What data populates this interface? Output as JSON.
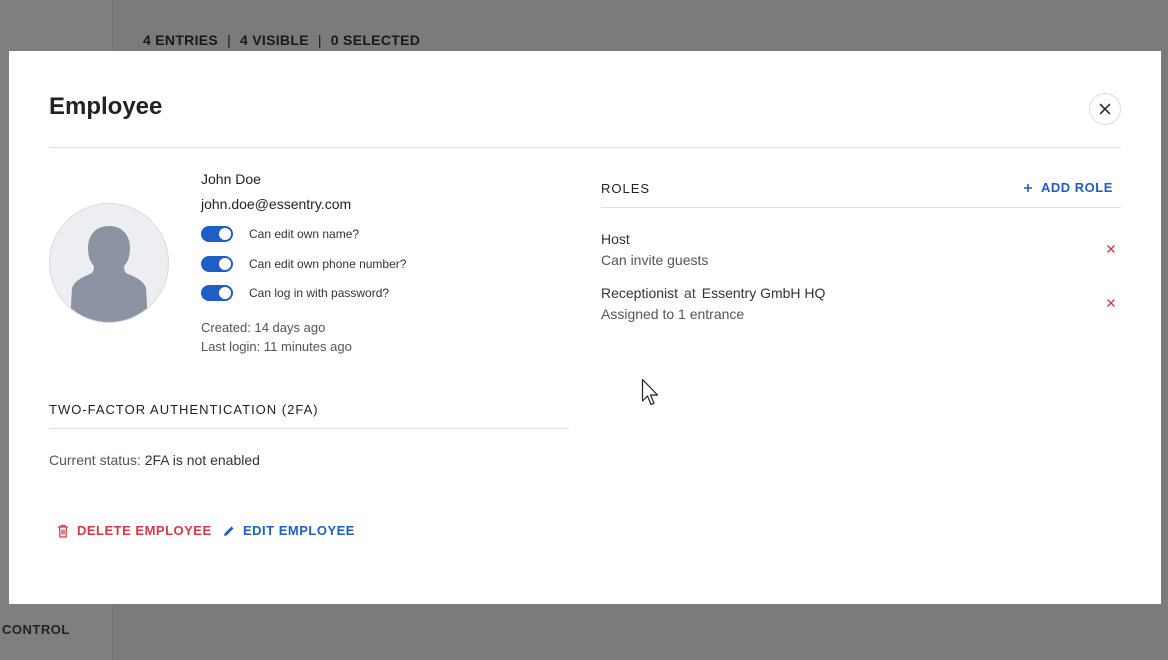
{
  "background": {
    "counts": {
      "entries": "4 ENTRIES",
      "visible": "4 VISIBLE",
      "selected": "0 SELECTED"
    },
    "sidebar_bottom_label": "CONTROL"
  },
  "modal": {
    "title": "Employee",
    "employee": {
      "name": "John Doe",
      "email": "john.doe@essentry.com",
      "permissions": [
        {
          "label": "Can edit own name?",
          "enabled": true
        },
        {
          "label": "Can edit own phone number?",
          "enabled": true
        },
        {
          "label": "Can log in with password?",
          "enabled": true
        }
      ],
      "created": "Created: 14 days ago",
      "last_login": "Last login: 11 minutes ago"
    },
    "two_factor": {
      "title": "TWO-FACTOR AUTHENTICATION (2FA)",
      "status_prefix": "Current status:",
      "status_value": "2FA is not enabled"
    },
    "actions": {
      "delete_label": "DELETE EMPLOYEE",
      "edit_label": "EDIT EMPLOYEE"
    },
    "roles": {
      "title": "ROLES",
      "add_label": "ADD ROLE",
      "items": [
        {
          "name": "Host",
          "description": "Can invite guests"
        },
        {
          "name": "Receptionist",
          "at": "at",
          "location": "Essentry GmbH HQ",
          "description": "Assigned to 1 entrance"
        }
      ]
    }
  },
  "colors": {
    "accent": "#1f5fc4",
    "danger": "#d23b46",
    "overlay": "rgba(0,0,0,0.5)"
  },
  "icons": [
    "close-icon",
    "trash-icon",
    "pencil-icon",
    "plus-icon",
    "remove-x-icon",
    "avatar-silhouette-icon",
    "mouse-cursor-icon"
  ]
}
